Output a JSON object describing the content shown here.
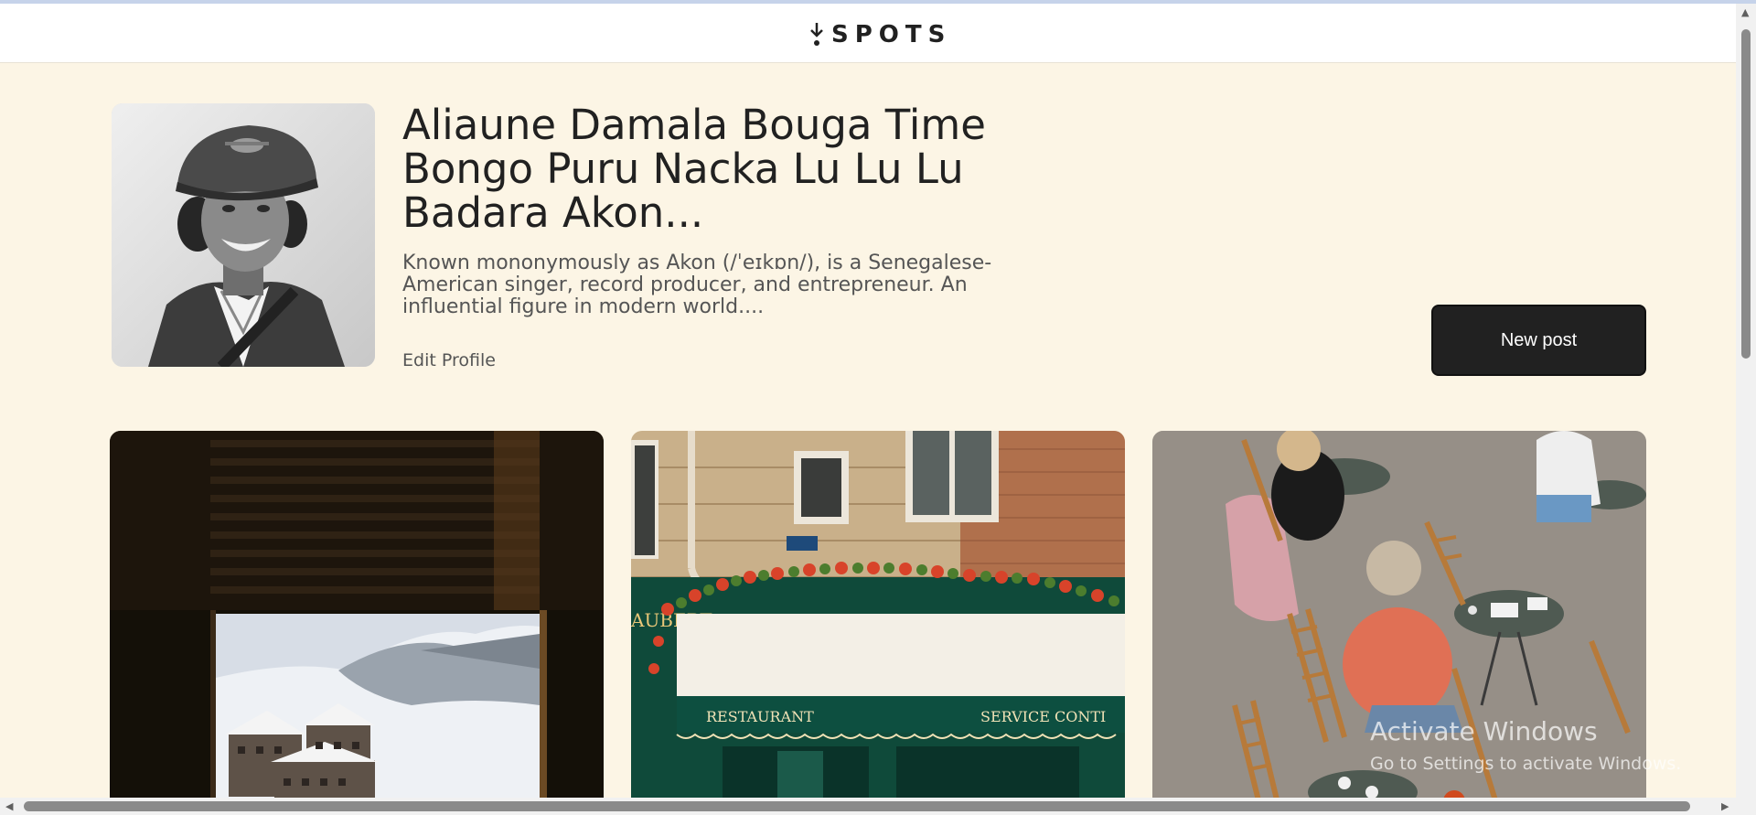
{
  "header": {
    "logo_text": "SPOTS"
  },
  "profile": {
    "name": "Aliaune Damala Bouga Time Bongo Puru Nacka Lu Lu Lu Badara Akon...",
    "bio": "Known mononymously as Akon (/ˈeɪkɒn/), is a Senegalese-American singer, record producer, and entrepreneur. An influential figure in modern world....",
    "edit_label": "Edit Profile",
    "new_post_label": "New post"
  },
  "cards": [
    {
      "subject": "window-view-snowy-mountains"
    },
    {
      "subject": "restaurant-storefront-with-flowers"
    },
    {
      "subject": "outdoor-cafe-terrace"
    }
  ],
  "watermark": {
    "title": "Activate Windows",
    "subtitle": "Go to Settings to activate Windows."
  },
  "colors": {
    "background": "#fcf5e5",
    "header": "#ffffff",
    "text": "#212121",
    "button": "#212121"
  }
}
